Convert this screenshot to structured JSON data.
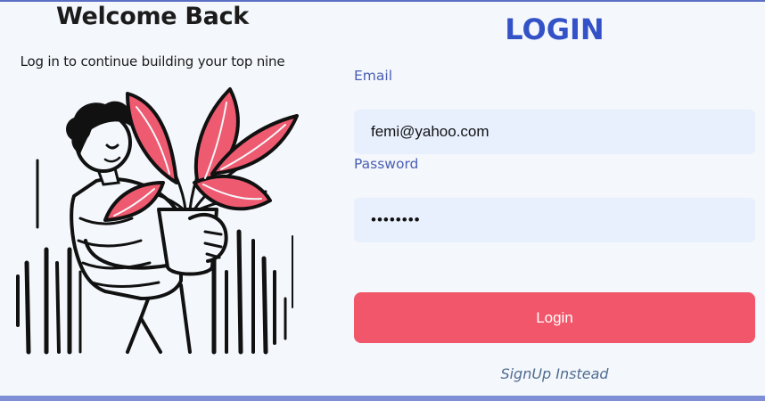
{
  "welcome": {
    "title": "Welcome Back",
    "subtitle": "Log in to continue building your top nine"
  },
  "login_form": {
    "title": "LOGIN",
    "email_label": "Email",
    "email_value": "femi@yahoo.com",
    "password_label": "Password",
    "password_value": "femipass",
    "submit_label": "Login",
    "signup_link": "SignUp Instead"
  },
  "colors": {
    "accent": "#3452c7",
    "button": "#f2566a",
    "input_bg": "#e8f0fe",
    "leaf": "#ee5a6f"
  }
}
